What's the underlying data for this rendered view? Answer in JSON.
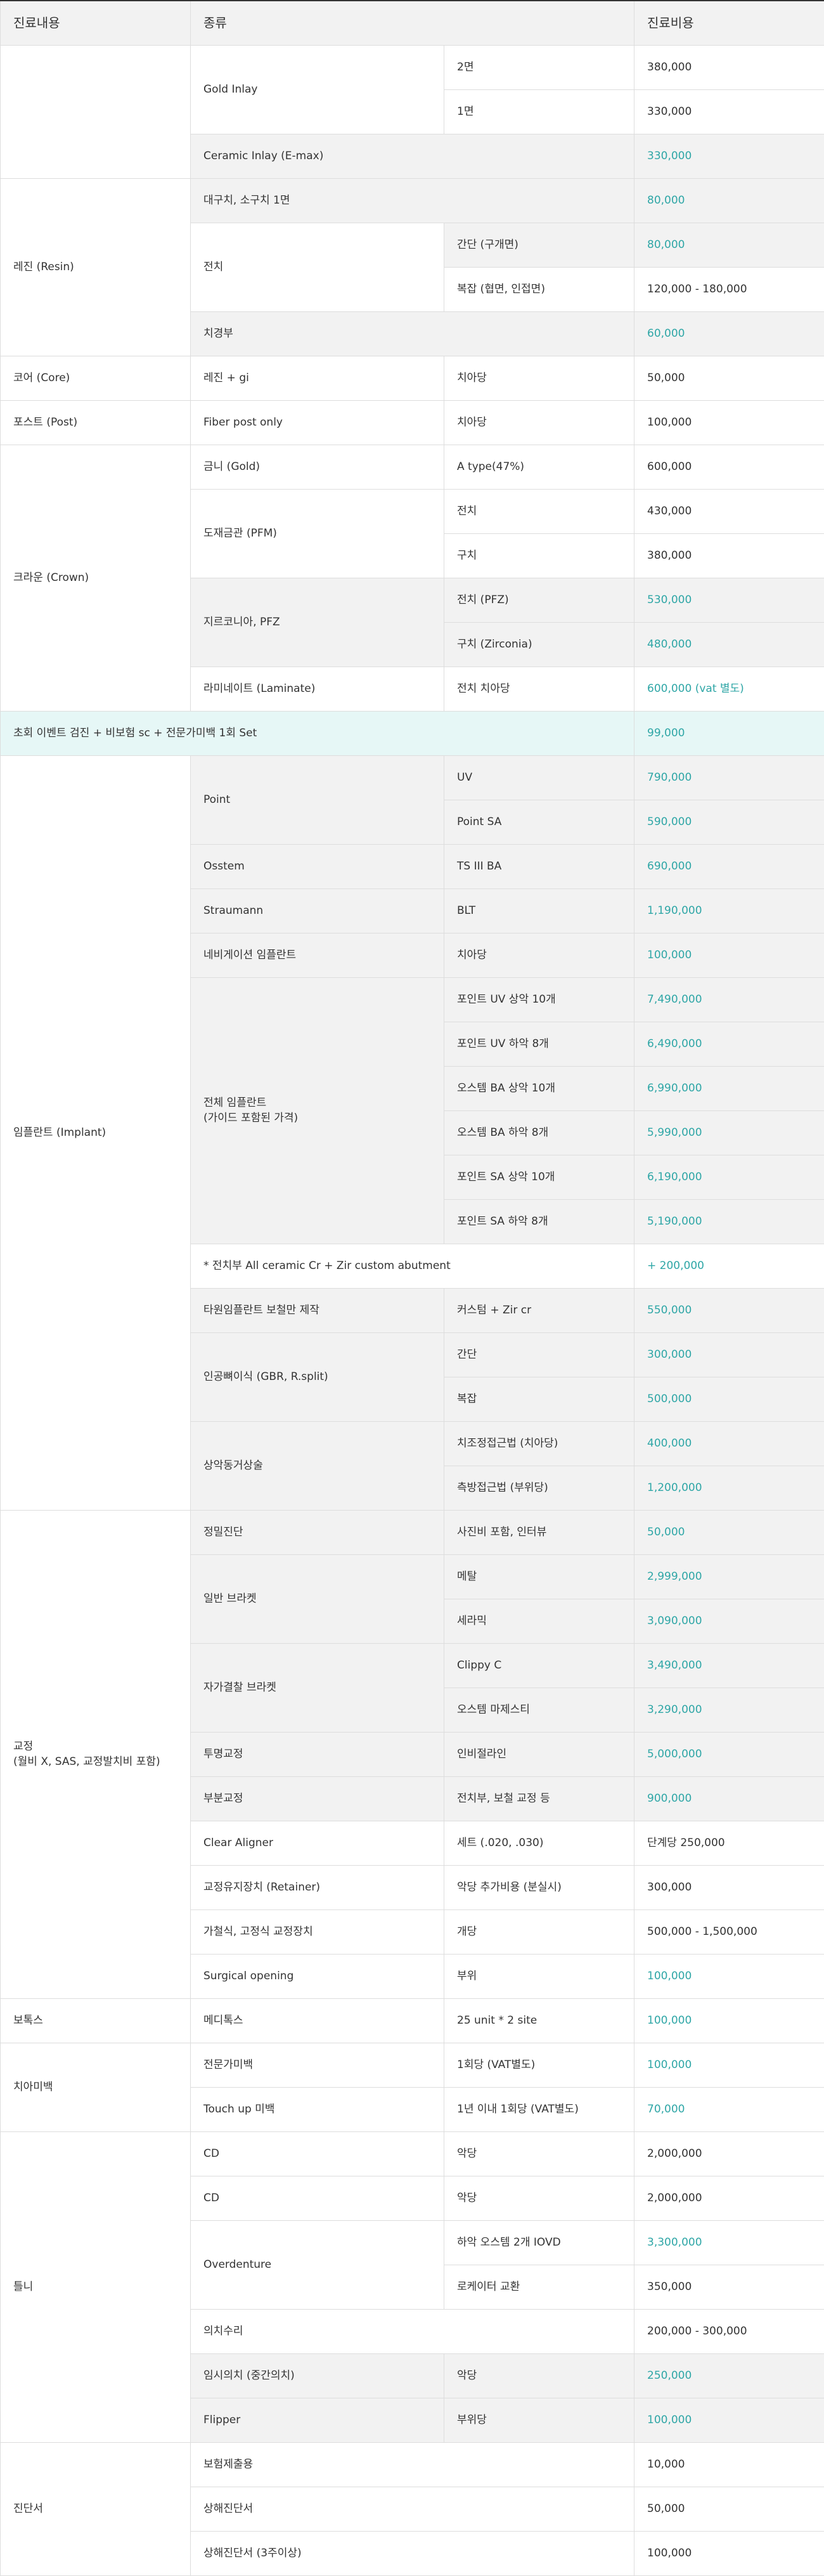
{
  "colors": {
    "accent": "#2ea6a6",
    "row_gray": "#f2f2f2",
    "event_row": "#e6f7f6",
    "border": "#dddddd"
  },
  "header": {
    "col1": "진료내용",
    "col2": "종류",
    "col3": "진료비용"
  },
  "rows": [
    [
      {
        "text": "",
        "rs": 3
      },
      {
        "text": "Gold Inlay",
        "rs": 2
      },
      {
        "text": "2면"
      },
      {
        "text": "380,000"
      }
    ],
    [
      {
        "text": "1면"
      },
      {
        "text": "330,000"
      }
    ],
    [
      {
        "text": "Ceramic Inlay (E-max)",
        "cs": 2,
        "bg": "gray"
      },
      {
        "text": "330,000",
        "teal": true,
        "bg": "gray"
      }
    ],
    [
      {
        "text": "레진 (Resin)",
        "rs": 4
      },
      {
        "text": "대구치, 소구치 1면",
        "cs": 2,
        "bg": "gray"
      },
      {
        "text": "80,000",
        "teal": true,
        "bg": "gray"
      }
    ],
    [
      {
        "text": "전치",
        "rs": 2
      },
      {
        "text": "간단 (구개면)",
        "bg": "gray"
      },
      {
        "text": "80,000",
        "teal": true,
        "bg": "gray"
      }
    ],
    [
      {
        "text": "복잡 (협면, 인접면)"
      },
      {
        "text": "120,000 - 180,000"
      }
    ],
    [
      {
        "text": "치경부",
        "cs": 2,
        "bg": "gray"
      },
      {
        "text": "60,000",
        "teal": true,
        "bg": "gray"
      }
    ],
    [
      {
        "text": "코어 (Core)"
      },
      {
        "text": "레진 + gi"
      },
      {
        "text": "치아당"
      },
      {
        "text": "50,000"
      }
    ],
    [
      {
        "text": "포스트 (Post)"
      },
      {
        "text": "Fiber post only"
      },
      {
        "text": "치아당"
      },
      {
        "text": "100,000"
      }
    ],
    [
      {
        "text": "크라운 (Crown)",
        "rs": 6
      },
      {
        "text": "금니 (Gold)"
      },
      {
        "text": "A type(47%)"
      },
      {
        "text": "600,000"
      }
    ],
    [
      {
        "text": "도재금관 (PFM)",
        "rs": 2
      },
      {
        "text": "전치"
      },
      {
        "text": "430,000"
      }
    ],
    [
      {
        "text": "구치"
      },
      {
        "text": "380,000"
      }
    ],
    [
      {
        "text": "지르코니아, PFZ",
        "rs": 2,
        "bg": "gray"
      },
      {
        "text": "전치 (PFZ)",
        "bg": "gray"
      },
      {
        "text": "530,000",
        "teal": true,
        "bg": "gray"
      }
    ],
    [
      {
        "text": "구치 (Zirconia)",
        "bg": "gray"
      },
      {
        "text": "480,000",
        "teal": true,
        "bg": "gray"
      }
    ],
    [
      {
        "text": "라미네이트 (Laminate)"
      },
      {
        "text": "전치 치아당"
      },
      {
        "text": "600,000 (vat 별도)",
        "teal": true
      }
    ],
    [
      {
        "text": "초회 이벤트 검진 + 비보험 sc + 전문가미백 1회 Set",
        "cs": 3,
        "bg": "event"
      },
      {
        "text": "99,000",
        "teal": true,
        "bg": "event"
      }
    ],
    [
      {
        "text": "임플란트 (Implant)",
        "rs": 17
      },
      {
        "text": "Point",
        "rs": 2,
        "bg": "gray"
      },
      {
        "text": "UV",
        "bg": "gray"
      },
      {
        "text": "790,000",
        "teal": true,
        "bg": "gray"
      }
    ],
    [
      {
        "text": "Point SA",
        "bg": "gray"
      },
      {
        "text": "590,000",
        "teal": true,
        "bg": "gray"
      }
    ],
    [
      {
        "text": "Osstem",
        "bg": "gray"
      },
      {
        "text": "TS III BA",
        "bg": "gray"
      },
      {
        "text": "690,000",
        "teal": true,
        "bg": "gray"
      }
    ],
    [
      {
        "text": "Straumann",
        "bg": "gray"
      },
      {
        "text": "BLT",
        "bg": "gray"
      },
      {
        "text": "1,190,000",
        "teal": true,
        "bg": "gray"
      }
    ],
    [
      {
        "text": "네비게이션 임플란트",
        "bg": "gray"
      },
      {
        "text": "치아당",
        "bg": "gray"
      },
      {
        "text": "100,000",
        "teal": true,
        "bg": "gray"
      }
    ],
    [
      {
        "text": "전체 임플란트\n(가이드 포함된 가격)",
        "rs": 6,
        "bg": "gray"
      },
      {
        "text": "포인트 UV 상악 10개",
        "bg": "gray"
      },
      {
        "text": "7,490,000",
        "teal": true,
        "bg": "gray"
      }
    ],
    [
      {
        "text": "포인트 UV 하악 8개",
        "bg": "gray"
      },
      {
        "text": "6,490,000",
        "teal": true,
        "bg": "gray"
      }
    ],
    [
      {
        "text": "오스템 BA 상악 10개",
        "bg": "gray"
      },
      {
        "text": "6,990,000",
        "teal": true,
        "bg": "gray"
      }
    ],
    [
      {
        "text": "오스템 BA 하악 8개",
        "bg": "gray"
      },
      {
        "text": "5,990,000",
        "teal": true,
        "bg": "gray"
      }
    ],
    [
      {
        "text": "포인트 SA 상악 10개",
        "bg": "gray"
      },
      {
        "text": "6,190,000",
        "teal": true,
        "bg": "gray"
      }
    ],
    [
      {
        "text": "포인트 SA 하악 8개",
        "bg": "gray"
      },
      {
        "text": "5,190,000",
        "teal": true,
        "bg": "gray"
      }
    ],
    [
      {
        "text": "* 전치부 All ceramic Cr + Zir custom abutment",
        "cs": 2
      },
      {
        "text": "+ 200,000",
        "teal": true
      }
    ],
    [
      {
        "text": "타원임플란트 보철만 제작",
        "bg": "gray"
      },
      {
        "text": "커스텀 + Zir cr",
        "bg": "gray"
      },
      {
        "text": "550,000",
        "teal": true,
        "bg": "gray"
      }
    ],
    [
      {
        "text": "인공뼈이식 (GBR, R.split)",
        "rs": 2,
        "bg": "gray"
      },
      {
        "text": "간단",
        "bg": "gray"
      },
      {
        "text": "300,000",
        "teal": true,
        "bg": "gray"
      }
    ],
    [
      {
        "text": "복잡",
        "bg": "gray"
      },
      {
        "text": "500,000",
        "teal": true,
        "bg": "gray"
      }
    ],
    [
      {
        "text": "상악동거상술",
        "rs": 2,
        "bg": "gray"
      },
      {
        "text": "치조정접근법 (치아당)",
        "bg": "gray"
      },
      {
        "text": "400,000",
        "teal": true,
        "bg": "gray"
      }
    ],
    [
      {
        "text": "측방접근법 (부위당)",
        "bg": "gray"
      },
      {
        "text": "1,200,000",
        "teal": true,
        "bg": "gray"
      }
    ],
    [
      {
        "text": "교정\n(월비 X, SAS, 교정발치비 포함)",
        "rs": 11
      },
      {
        "text": "정밀진단",
        "bg": "gray"
      },
      {
        "text": "사진비 포함, 인터뷰",
        "bg": "gray"
      },
      {
        "text": "50,000",
        "teal": true,
        "bg": "gray"
      }
    ],
    [
      {
        "text": "일반 브라켓",
        "rs": 2,
        "bg": "gray"
      },
      {
        "text": "메탈",
        "bg": "gray"
      },
      {
        "text": "2,999,000",
        "teal": true,
        "bg": "gray"
      }
    ],
    [
      {
        "text": "세라믹",
        "bg": "gray"
      },
      {
        "text": "3,090,000",
        "teal": true,
        "bg": "gray"
      }
    ],
    [
      {
        "text": "자가결찰 브라켓",
        "rs": 2,
        "bg": "gray"
      },
      {
        "text": "Clippy C",
        "bg": "gray"
      },
      {
        "text": "3,490,000",
        "teal": true,
        "bg": "gray"
      }
    ],
    [
      {
        "text": "오스템 마제스티",
        "bg": "gray"
      },
      {
        "text": "3,290,000",
        "teal": true,
        "bg": "gray"
      }
    ],
    [
      {
        "text": "투명교정",
        "bg": "gray"
      },
      {
        "text": "인비절라인",
        "bg": "gray"
      },
      {
        "text": "5,000,000",
        "teal": true,
        "bg": "gray"
      }
    ],
    [
      {
        "text": "부분교정",
        "bg": "gray"
      },
      {
        "text": "전치부, 보철 교정 등",
        "bg": "gray"
      },
      {
        "text": "900,000",
        "teal": true,
        "bg": "gray"
      }
    ],
    [
      {
        "text": "Clear Aligner"
      },
      {
        "text": "세트 (.020, .030)"
      },
      {
        "text": "단계당 250,000"
      }
    ],
    [
      {
        "text": "교정유지장치 (Retainer)"
      },
      {
        "text": "악당 추가비용 (분실시)"
      },
      {
        "text": "300,000"
      }
    ],
    [
      {
        "text": "가철식, 고정식 교정장치"
      },
      {
        "text": "개당"
      },
      {
        "text": "500,000 - 1,500,000"
      }
    ],
    [
      {
        "text": "Surgical opening"
      },
      {
        "text": "부위"
      },
      {
        "text": "100,000",
        "teal": true
      }
    ],
    [
      {
        "text": "보톡스"
      },
      {
        "text": "메디톡스"
      },
      {
        "text": "25 unit * 2 site"
      },
      {
        "text": "100,000",
        "teal": true
      }
    ],
    [
      {
        "text": "치아미백",
        "rs": 2
      },
      {
        "text": "전문가미백"
      },
      {
        "text": "1회당 (VAT별도)"
      },
      {
        "text": "100,000",
        "teal": true
      }
    ],
    [
      {
        "text": "Touch up 미백"
      },
      {
        "text": "1년 이내 1회당 (VAT별도)"
      },
      {
        "text": "70,000",
        "teal": true
      }
    ],
    [
      {
        "text": "틀니",
        "rs": 7
      },
      {
        "text": "CD"
      },
      {
        "text": "악당"
      },
      {
        "text": "2,000,000"
      }
    ],
    [
      {
        "text": "CD"
      },
      {
        "text": "악당"
      },
      {
        "text": "2,000,000"
      }
    ],
    [
      {
        "text": "Overdenture",
        "rs": 2
      },
      {
        "text": "하악 오스템 2개 IOVD"
      },
      {
        "text": "3,300,000",
        "teal": true
      }
    ],
    [
      {
        "text": "로케이터 교환"
      },
      {
        "text": "350,000"
      }
    ],
    [
      {
        "text": "의치수리",
        "cs": 2
      },
      {
        "text": "200,000 - 300,000"
      }
    ],
    [
      {
        "text": "임시의치 (중간의치)",
        "bg": "gray"
      },
      {
        "text": "악당",
        "bg": "gray"
      },
      {
        "text": "250,000",
        "teal": true,
        "bg": "gray"
      }
    ],
    [
      {
        "text": "Flipper",
        "bg": "gray"
      },
      {
        "text": "부위당",
        "bg": "gray"
      },
      {
        "text": "100,000",
        "teal": true,
        "bg": "gray"
      }
    ],
    [
      {
        "text": "진단서",
        "rs": 3
      },
      {
        "text": "보험제출용",
        "cs": 2
      },
      {
        "text": "10,000"
      }
    ],
    [
      {
        "text": "상해진단서",
        "cs": 2
      },
      {
        "text": "50,000"
      }
    ],
    [
      {
        "text": "상해진단서 (3주이상)",
        "cs": 2
      },
      {
        "text": "100,000"
      }
    ]
  ]
}
